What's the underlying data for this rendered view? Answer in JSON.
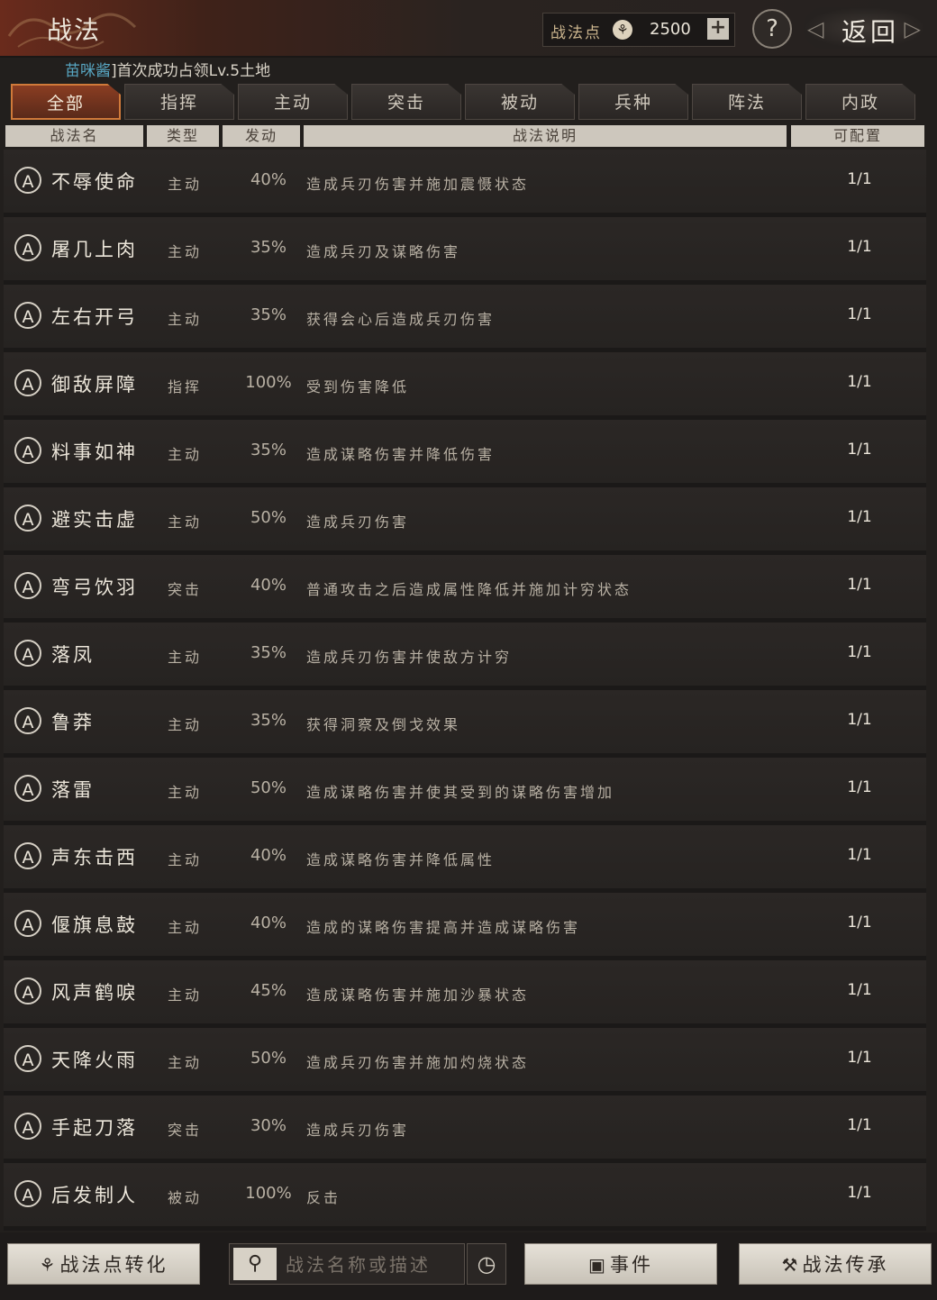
{
  "header": {
    "title": "战法",
    "points_label": "战法点",
    "points_value": "2500",
    "back_label": "返回"
  },
  "notice": {
    "user": "苗咪酱",
    "text": "]首次成功占领Lv.5土地"
  },
  "tabs": [
    {
      "label": "全部",
      "active": true
    },
    {
      "label": "指挥"
    },
    {
      "label": "主动"
    },
    {
      "label": "突击"
    },
    {
      "label": "被动"
    },
    {
      "label": "兵种"
    },
    {
      "label": "阵法"
    },
    {
      "label": "内政"
    }
  ],
  "columns": {
    "name": "战法名",
    "type": "类型",
    "rate": "发动",
    "desc": "战法说明",
    "quota": "可配置"
  },
  "rows": [
    {
      "grade": "A",
      "name": "不辱使命",
      "type": "主动",
      "rate": "40%",
      "desc": "造成兵刃伤害并施加震慑状态",
      "quota": "1/1"
    },
    {
      "grade": "A",
      "name": "屠几上肉",
      "type": "主动",
      "rate": "35%",
      "desc": "造成兵刃及谋略伤害",
      "quota": "1/1"
    },
    {
      "grade": "A",
      "name": "左右开弓",
      "type": "主动",
      "rate": "35%",
      "desc": "获得会心后造成兵刃伤害",
      "quota": "1/1"
    },
    {
      "grade": "A",
      "name": "御敌屏障",
      "type": "指挥",
      "rate": "100%",
      "desc": "受到伤害降低",
      "quota": "1/1"
    },
    {
      "grade": "A",
      "name": "料事如神",
      "type": "主动",
      "rate": "35%",
      "desc": "造成谋略伤害并降低伤害",
      "quota": "1/1"
    },
    {
      "grade": "A",
      "name": "避实击虚",
      "type": "主动",
      "rate": "50%",
      "desc": "造成兵刃伤害",
      "quota": "1/1"
    },
    {
      "grade": "A",
      "name": "弯弓饮羽",
      "type": "突击",
      "rate": "40%",
      "desc": "普通攻击之后造成属性降低并施加计穷状态",
      "quota": "1/1"
    },
    {
      "grade": "A",
      "name": "落凤",
      "type": "主动",
      "rate": "35%",
      "desc": "造成兵刃伤害并使敌方计穷",
      "quota": "1/1"
    },
    {
      "grade": "A",
      "name": "鲁莽",
      "type": "主动",
      "rate": "35%",
      "desc": "获得洞察及倒戈效果",
      "quota": "1/1"
    },
    {
      "grade": "A",
      "name": "落雷",
      "type": "主动",
      "rate": "50%",
      "desc": "造成谋略伤害并使其受到的谋略伤害增加",
      "quota": "1/1"
    },
    {
      "grade": "A",
      "name": "声东击西",
      "type": "主动",
      "rate": "40%",
      "desc": "造成谋略伤害并降低属性",
      "quota": "1/1"
    },
    {
      "grade": "A",
      "name": "偃旗息鼓",
      "type": "主动",
      "rate": "40%",
      "desc": "造成的谋略伤害提高并造成谋略伤害",
      "quota": "1/1"
    },
    {
      "grade": "A",
      "name": "风声鹤唳",
      "type": "主动",
      "rate": "45%",
      "desc": "造成谋略伤害并施加沙暴状态",
      "quota": "1/1"
    },
    {
      "grade": "A",
      "name": "天降火雨",
      "type": "主动",
      "rate": "50%",
      "desc": "造成兵刃伤害并施加灼烧状态",
      "quota": "1/1"
    },
    {
      "grade": "A",
      "name": "手起刀落",
      "type": "突击",
      "rate": "30%",
      "desc": "造成兵刃伤害",
      "quota": "1/1"
    },
    {
      "grade": "A",
      "name": "后发制人",
      "type": "被动",
      "rate": "100%",
      "desc": "反击",
      "quota": "1/1"
    }
  ],
  "bottom": {
    "convert_label": "战法点转化",
    "search_placeholder": "战法名称或描述",
    "event_label": "事件",
    "inherit_label": "战法传承"
  }
}
